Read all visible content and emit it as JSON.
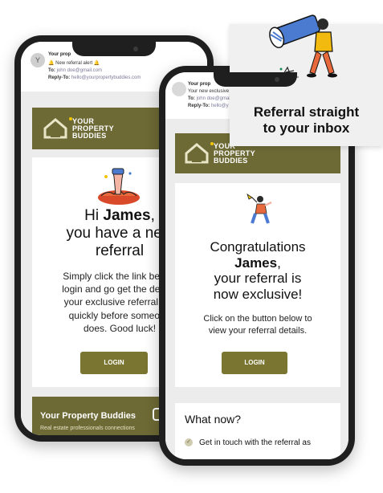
{
  "left_phone": {
    "avatar_letter": "Y",
    "email_subject": "Your prop",
    "email_preview": "New referral alert",
    "to_label": "To:",
    "to_value": "john doe@gmail.com",
    "reply_label": "Reply-To:",
    "reply_value": "hello@yourpropertybuddies.com",
    "logo_lines": [
      "YOUR",
      "PROPERTY",
      "BUDDIES"
    ],
    "greeting_prefix": "Hi ",
    "greeting_name": "James",
    "greeting_suffix": ",",
    "heading_line2": "you have a new",
    "heading_line3": "referral",
    "body_lines": [
      "Simply click the link below,",
      "login and go get the details",
      "your exclusive referral. Bu",
      "quickly before someone",
      "does. Good luck!"
    ],
    "button_label": "LOGIN",
    "footer_title": "Your Property Buddies",
    "footer_sub": "Real estate professionals connections"
  },
  "right_phone": {
    "email_subject": "Your prop",
    "email_preview": "Your new exclusive",
    "to_label": "To:",
    "to_value": "john doe@gmail.",
    "reply_label": "Reply-To:",
    "reply_value": "hello@y",
    "logo_lines": [
      "YOUR",
      "PROPERTY",
      "BUDDIES"
    ],
    "heading_line1": "Congratulations",
    "heading_name": "James",
    "heading_suffix": ",",
    "heading_line3": "your referral is",
    "heading_line4": "now exclusive!",
    "body_lines": [
      "Click on the button below to",
      "view your referral details."
    ],
    "button_label": "LOGIN",
    "section_title": "What now?",
    "step1": "Get in touch with the referral as"
  },
  "callout": {
    "title_line1": "Referral straight",
    "title_line2": "to your inbox"
  },
  "colors": {
    "brand_olive": "#6e6a35",
    "button_olive": "#7a7530",
    "logo_accent": "#f2c500"
  }
}
